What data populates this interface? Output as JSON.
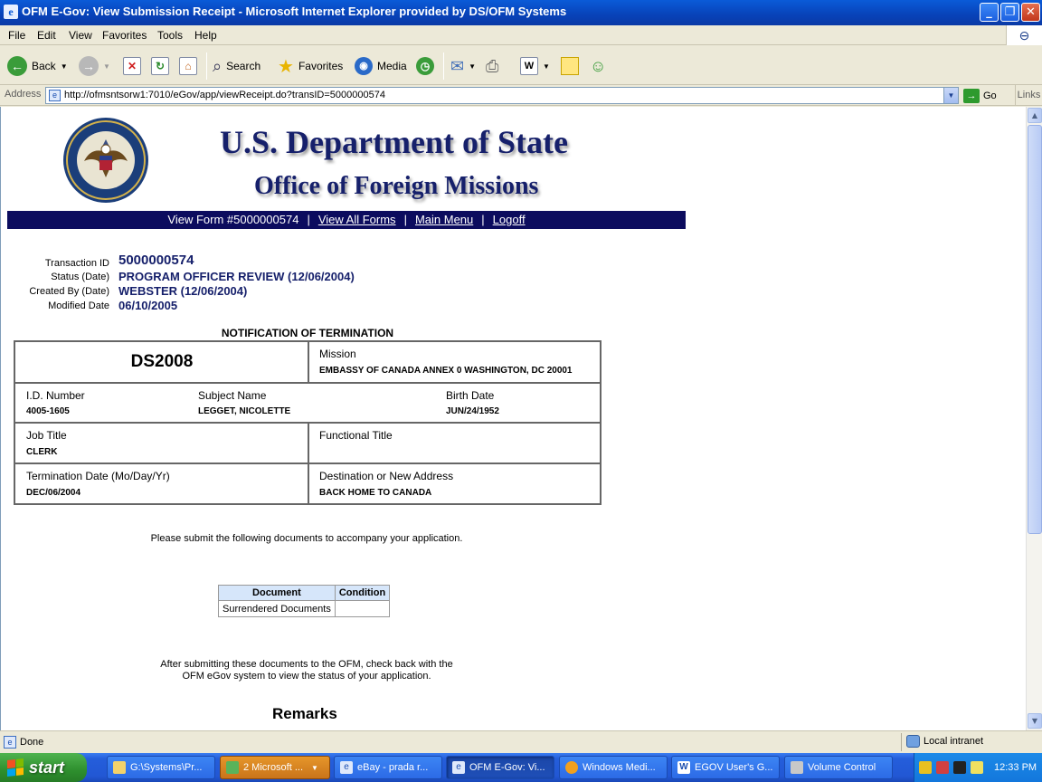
{
  "window": {
    "title": "OFM E-Gov: View Submission Receipt - Microsoft Internet Explorer provided by DS/OFM Systems",
    "app_icon": "e",
    "minimize": "_",
    "maximize": "❐",
    "close": "✕"
  },
  "menu": {
    "items": [
      "File",
      "Edit",
      "View",
      "Favorites",
      "Tools",
      "Help"
    ]
  },
  "toolbar": {
    "back_label": "Back",
    "search_label": "Search",
    "favorites_label": "Favorites",
    "media_label": "Media"
  },
  "address": {
    "label": "Address",
    "url": "http://ofmsntsorw1:7010/eGov/app/viewReceipt.do?transID=5000000574",
    "go_label": "Go",
    "links_label": "Links"
  },
  "page": {
    "title_main": "U.S. Department of State",
    "title_sub": "Office of Foreign Missions",
    "seal_text": "DEPARTMENT OF STATE · UNITED STATES OF AMERICA",
    "nav": {
      "current": "View Form #5000000574",
      "view_all": "View All Forms",
      "main_menu": "Main Menu",
      "logoff": "Logoff",
      "sep": "|"
    },
    "meta": {
      "transaction_id_label": "Transaction ID",
      "transaction_id": "5000000574",
      "status_label": "Status (Date)",
      "status": "PROGRAM OFFICER REVIEW (12/06/2004)",
      "created_label": "Created By (Date)",
      "created": "WEBSTER (12/06/2004)",
      "modified_label": "Modified Date",
      "modified": "06/10/2005"
    },
    "form": {
      "heading": "NOTIFICATION OF TERMINATION",
      "form_number": "DS2008",
      "mission_label": "Mission",
      "mission": "EMBASSY OF CANADA ANNEX 0 WASHINGTON, DC 20001",
      "id_label": "I.D. Number",
      "id": "4005-1605",
      "subject_label": "Subject Name",
      "subject": "LEGGET, NICOLETTE",
      "birth_label": "Birth Date",
      "birth": "JUN/24/1952",
      "job_label": "Job Title",
      "job": "CLERK",
      "functional_label": "Functional Title",
      "functional": "",
      "termination_label": "Termination Date (Mo/Day/Yr)",
      "termination": "DEC/06/2004",
      "destination_label": "Destination or New Address",
      "destination": "BACK HOME TO CANADA"
    },
    "submit_note": "Please submit the following documents to accompany your application.",
    "docs": {
      "col_document": "Document",
      "col_condition": "Condition",
      "rows": [
        {
          "document": "Surrendered Documents",
          "condition": ""
        }
      ]
    },
    "after_note_line1": "After submitting these documents to the OFM, check back with the",
    "after_note_line2": "OFM eGov system to view the status of your application.",
    "remarks": "Remarks"
  },
  "status": {
    "text": "Done",
    "zone": "Local intranet"
  },
  "taskbar": {
    "start": "start",
    "tasks": [
      "G:\\Systems\\Pr...",
      "2 Microsoft ...",
      "eBay - prada r...",
      "OFM E-Gov: Vi...",
      "Windows Medi...",
      "EGOV User's G...",
      "Volume Control"
    ],
    "clock": "12:33 PM"
  },
  "colors": {
    "header_navy": "#16206b",
    "nav_bar": "#0c0c5e",
    "doc_header": "#d6e6fa"
  }
}
